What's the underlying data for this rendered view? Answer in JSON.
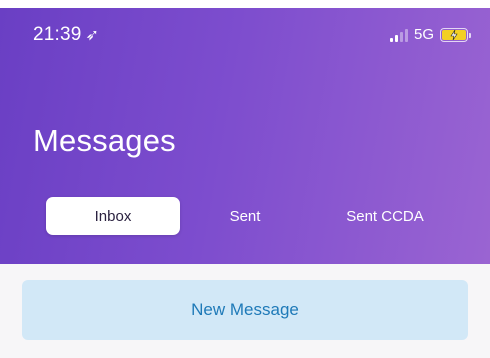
{
  "status_bar": {
    "time": "21:39",
    "network": "5G"
  },
  "header": {
    "title": "Messages"
  },
  "tabs": [
    {
      "label": "Inbox",
      "active": true
    },
    {
      "label": "Sent",
      "active": false
    },
    {
      "label": "Sent CCDA",
      "active": false
    }
  ],
  "actions": {
    "new_message": "New Message"
  },
  "colors": {
    "header_gradient_start": "#6a3fc4",
    "header_gradient_end": "#9a64d2",
    "battery": "#f2d024",
    "button_bg": "#d2e8f7",
    "button_text": "#1f7ab8"
  }
}
